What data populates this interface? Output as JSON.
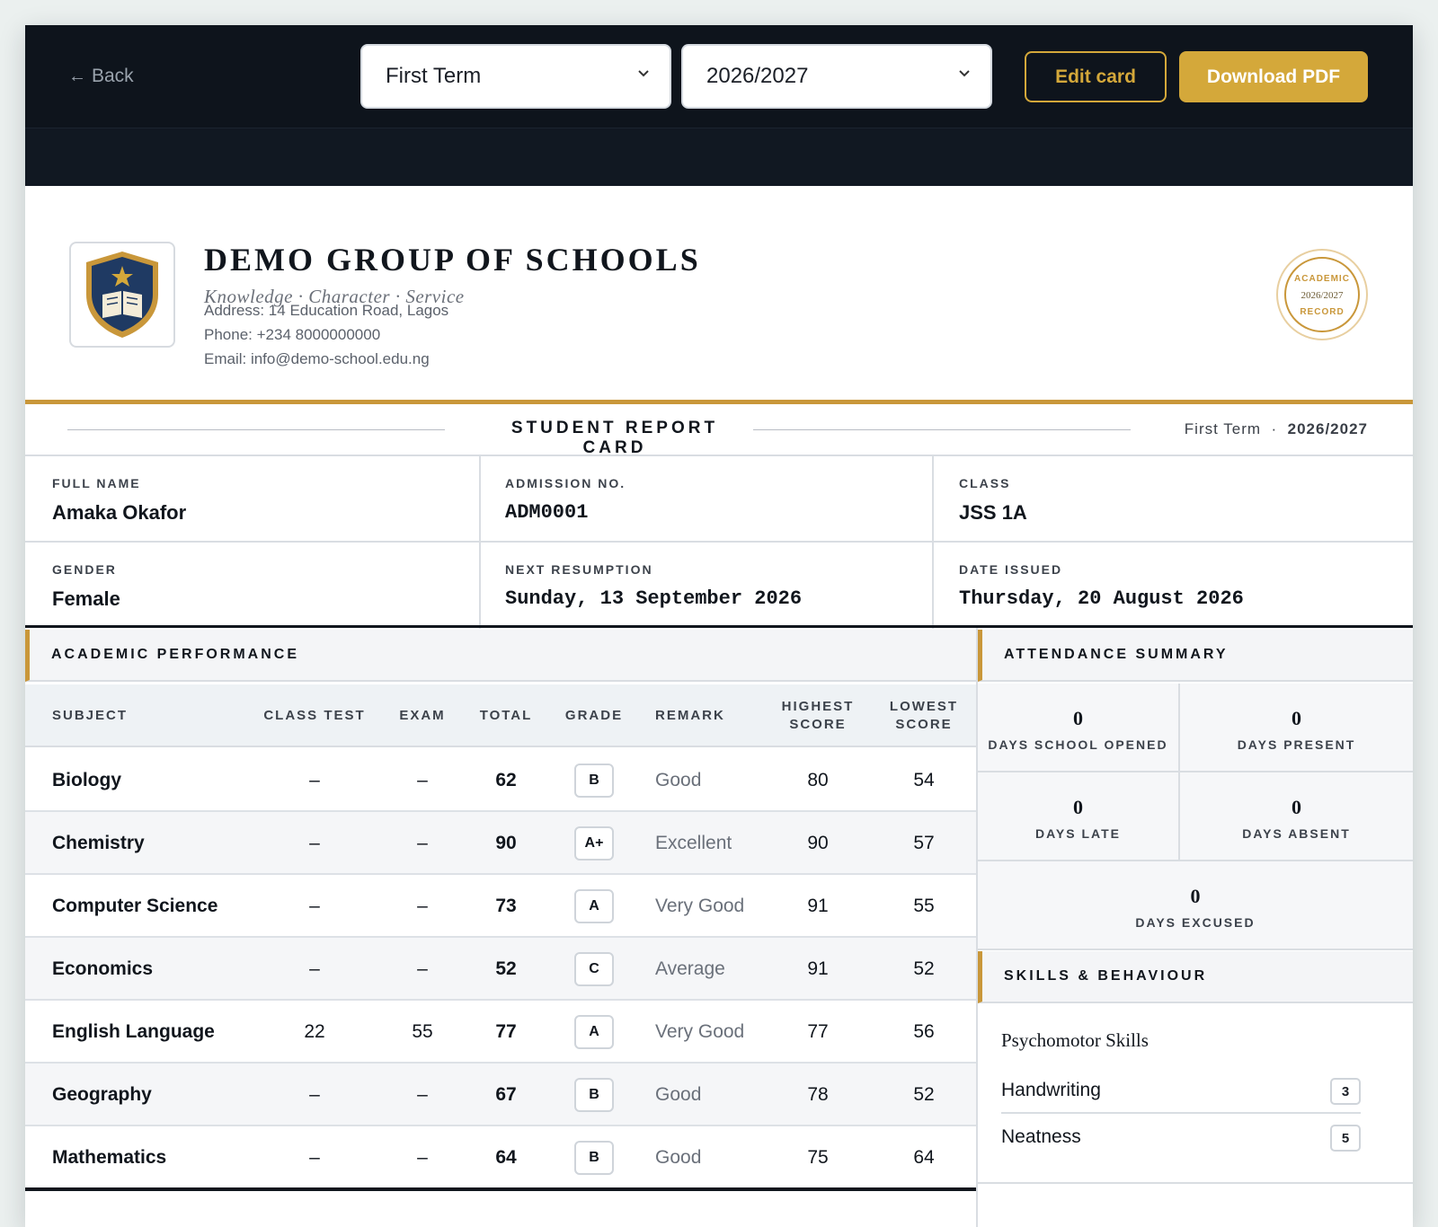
{
  "toolbar": {
    "back_label": "Back",
    "term_select": "First Term",
    "session_select": "2026/2027",
    "edit_label": "Edit card",
    "download_label": "Download PDF"
  },
  "school": {
    "name": "DEMO GROUP OF SCHOOLS",
    "motto": "Knowledge · Character · Service",
    "address": "Address: 14 Education Road, Lagos",
    "phone": "Phone: +234 8000000000",
    "email": "Email: info@demo-school.edu.ng",
    "seal_top": "ACADEMIC",
    "seal_mid": "2026/2027",
    "seal_bottom": "RECORD"
  },
  "report": {
    "title": "STUDENT REPORT CARD",
    "term": "First Term",
    "separator": "·",
    "session": "2026/2027"
  },
  "student": {
    "full_name_label": "FULL NAME",
    "full_name": "Amaka Okafor",
    "admission_label": "ADMISSION NO.",
    "admission": "ADM0001",
    "class_label": "CLASS",
    "class": "JSS 1A",
    "gender_label": "GENDER",
    "gender": "Female",
    "resumption_label": "NEXT RESUMPTION",
    "resumption": "Sunday, 13 September 2026",
    "issued_label": "DATE ISSUED",
    "issued": "Thursday, 20 August 2026"
  },
  "performance": {
    "title": "ACADEMIC PERFORMANCE",
    "headers": {
      "subject": "SUBJECT",
      "class_test": "CLASS TEST",
      "exam": "EXAM",
      "total": "TOTAL",
      "grade": "GRADE",
      "remark": "REMARK",
      "highest_1": "HIGHEST",
      "highest_2": "SCORE",
      "lowest_1": "LOWEST",
      "lowest_2": "SCORE"
    },
    "rows": [
      {
        "subject": "Biology",
        "class_test": "–",
        "exam": "–",
        "total": "62",
        "grade": "B",
        "remark": "Good",
        "highest": "80",
        "lowest": "54"
      },
      {
        "subject": "Chemistry",
        "class_test": "–",
        "exam": "–",
        "total": "90",
        "grade": "A+",
        "remark": "Excellent",
        "highest": "90",
        "lowest": "57"
      },
      {
        "subject": "Computer Science",
        "class_test": "–",
        "exam": "–",
        "total": "73",
        "grade": "A",
        "remark": "Very Good",
        "highest": "91",
        "lowest": "55"
      },
      {
        "subject": "Economics",
        "class_test": "–",
        "exam": "–",
        "total": "52",
        "grade": "C",
        "remark": "Average",
        "highest": "91",
        "lowest": "52"
      },
      {
        "subject": "English Language",
        "class_test": "22",
        "exam": "55",
        "total": "77",
        "grade": "A",
        "remark": "Very Good",
        "highest": "77",
        "lowest": "56"
      },
      {
        "subject": "Geography",
        "class_test": "–",
        "exam": "–",
        "total": "67",
        "grade": "B",
        "remark": "Good",
        "highest": "78",
        "lowest": "52"
      },
      {
        "subject": "Mathematics",
        "class_test": "–",
        "exam": "–",
        "total": "64",
        "grade": "B",
        "remark": "Good",
        "highest": "75",
        "lowest": "64"
      }
    ]
  },
  "attendance": {
    "title": "ATTENDANCE SUMMARY",
    "opened_value": "0",
    "opened_label": "DAYS SCHOOL OPENED",
    "present_value": "0",
    "present_label": "DAYS PRESENT",
    "late_value": "0",
    "late_label": "DAYS LATE",
    "absent_value": "0",
    "absent_label": "DAYS ABSENT",
    "excused_value": "0",
    "excused_label": "DAYS EXCUSED"
  },
  "skills": {
    "title": "SKILLS & BEHAVIOUR",
    "group_title": "Psychomotor Skills",
    "items": [
      {
        "name": "Handwriting",
        "score": "3"
      },
      {
        "name": "Neatness",
        "score": "5"
      }
    ]
  },
  "colors": {
    "accent": "#d4a83a",
    "topbar": "#0e141c",
    "crest_navy": "#1f3a63"
  }
}
